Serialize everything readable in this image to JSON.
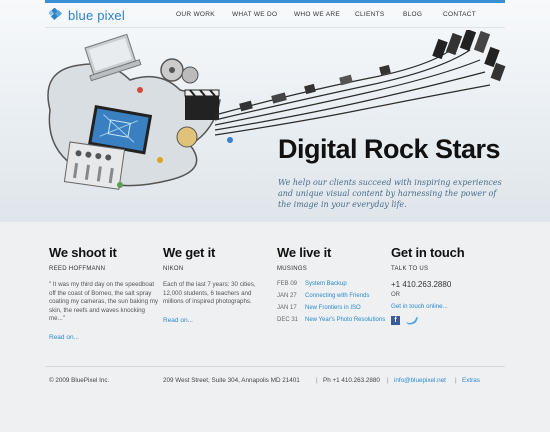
{
  "brand": {
    "name": "blue pixel"
  },
  "nav": [
    "OUR WORK",
    "WHAT WE DO",
    "WHO WE ARE",
    "CLIENTS",
    "BLOG",
    "CONTACT"
  ],
  "hero": {
    "title": "Digital Rock Stars",
    "tagline": "We help our clients succeed with inspiring experiences and unique visual content by harnessing the power of the image in your everyday life."
  },
  "columns": {
    "shoot": {
      "heading": "We shoot it",
      "sub": "REED HOFFMANN",
      "body": "\" It was my third day on the speedboat off the coast of Borneo, the salt spray coating my cameras, the sun baking my skin, the reefs and waves knocking me...\"",
      "link": "Read on..."
    },
    "get": {
      "heading": "We get it",
      "sub": "NIKON",
      "body": "Each of the last 7 years: 30 cities, 12,000 students, 6 teachers and millions of inspired photographs.",
      "link": "Read on..."
    },
    "live": {
      "heading": "We live it",
      "sub": "MUSINGS",
      "items": [
        {
          "date": "FEB 09",
          "title": "System Backup"
        },
        {
          "date": "JAN 27",
          "title": "Connecting with Friends"
        },
        {
          "date": "JAN 17",
          "title": "New Frontiers in ISO"
        },
        {
          "date": "DEC 31",
          "title": "New Year's Photo Resolutions"
        }
      ]
    },
    "touch": {
      "heading": "Get in touch",
      "sub": "TALK TO US",
      "phone": "+1 410.263.2880",
      "or": "OR",
      "link": "Get in touch online..."
    }
  },
  "footer": {
    "copyright": "© 2009 BluePixel Inc.",
    "address": "209 West Street, Suite 304, Annapolis MD 21401",
    "sep1": "|",
    "phone": "Ph +1 410.263.2880",
    "sep2": "|",
    "email": "info@bluepixel.net",
    "sep3": "|",
    "extras": "Extras"
  },
  "colors": {
    "accent": "#2b8ad0",
    "brand": "#2b83c6",
    "topbar": "#3a8fd6"
  },
  "icons": [
    "logo-diamond-icon",
    "facebook-icon",
    "twitter-bird-icon"
  ]
}
